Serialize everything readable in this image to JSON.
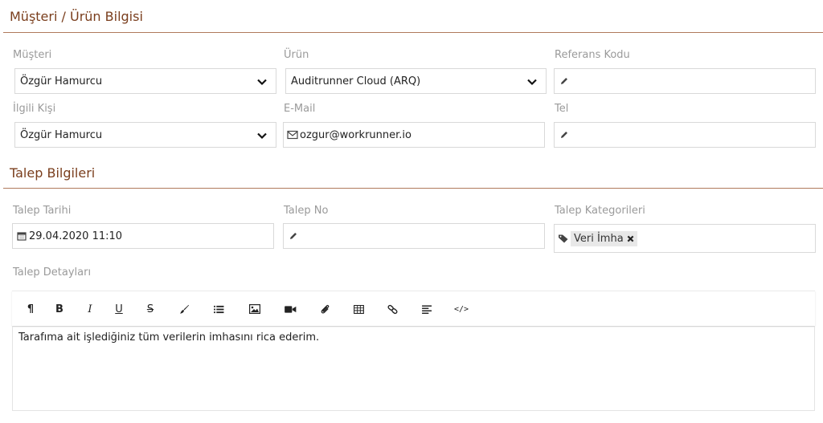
{
  "sections": {
    "customer_product_title": "Müşteri / Ürün Bilgisi",
    "request_title": "Talep Bilgileri"
  },
  "customer": {
    "label": "Müşteri",
    "value": "Özgür Hamurcu"
  },
  "product": {
    "label": "Ürün",
    "value": "Auditrunner Cloud (ARQ)"
  },
  "reference": {
    "label": "Referans Kodu",
    "value": ""
  },
  "contact": {
    "label": "İlgili Kişi",
    "value": "Özgür Hamurcu"
  },
  "email": {
    "label": "E-Mail",
    "value": "ozgur@workrunner.io"
  },
  "phone": {
    "label": "Tel",
    "value": ""
  },
  "request_date": {
    "label": "Talep Tarihi",
    "value": "29.04.2020 11:10"
  },
  "request_no": {
    "label": "Talep No",
    "value": ""
  },
  "request_categories": {
    "label": "Talep Kategorileri",
    "tags": [
      "Veri İmha"
    ]
  },
  "request_details": {
    "label": "Talep Detayları",
    "content": "Tarafıma ait işlediğiniz tüm verilerin imhasını rica ederim."
  },
  "toolbar": {
    "paragraph": "¶",
    "bold": "B",
    "italic": "I",
    "underline": "U",
    "strike": "S",
    "code": "</>"
  },
  "colors": {
    "section_title": "#7a3e1d",
    "section_rule": "#b07a5c",
    "label": "#9a9a9a",
    "border": "#d9d9d9",
    "tag_bg": "#e8e8e8"
  },
  "icons": [
    "chevron-down-icon",
    "pencil-icon",
    "envelope-icon",
    "calendar-icon",
    "tag-icon",
    "close-icon",
    "paragraph-icon",
    "bold-icon",
    "italic-icon",
    "underline-icon",
    "strikethrough-icon",
    "brush-icon",
    "list-icon",
    "image-icon",
    "video-icon",
    "paperclip-icon",
    "table-icon",
    "link-icon",
    "align-left-icon",
    "code-icon"
  ]
}
